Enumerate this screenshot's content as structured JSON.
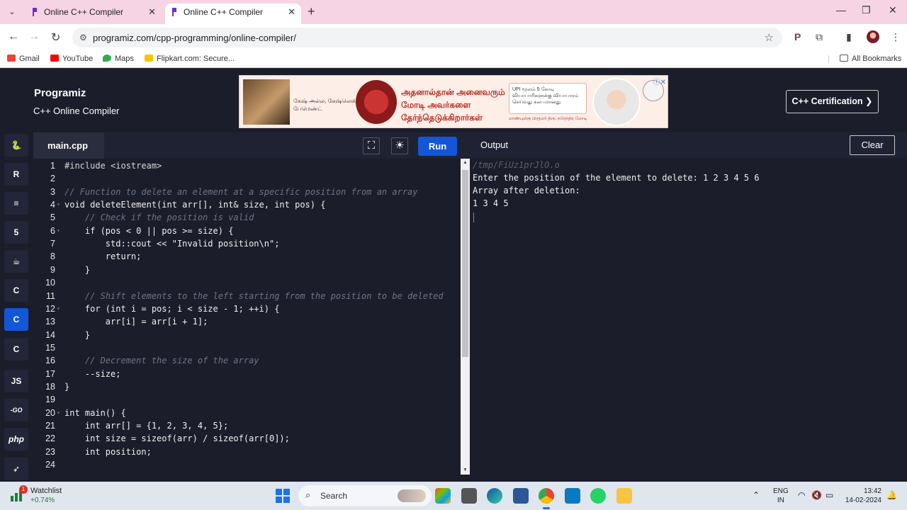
{
  "browser": {
    "tabs": [
      {
        "title": "Online C++ Compiler",
        "active": false
      },
      {
        "title": "Online C++ Compiler",
        "active": true
      }
    ],
    "url": "programiz.com/cpp-programming/online-compiler/",
    "bookmarks": [
      {
        "label": "Gmail",
        "icon": "gmail-icon",
        "color": "#ea4335"
      },
      {
        "label": "YouTube",
        "icon": "youtube-icon",
        "color": "#ff0000"
      },
      {
        "label": "Maps",
        "icon": "maps-icon",
        "color": "#34a853"
      },
      {
        "label": "Flipkart.com: Secure...",
        "icon": "flipkart-icon",
        "color": "#f7c600"
      }
    ],
    "all_bookmarks": "All Bookmarks"
  },
  "site": {
    "logo": "Programiz",
    "subtitle": "C++ Online Compiler",
    "certification": "C++ Certification ❯"
  },
  "ad": {
    "text_left": "கேஷ் அல்ல, கேஷ்லெஸ் பேமெண்ட்",
    "text_main": "அதனால்தான் அனைவரும் மோடி அவர்களை தேர்ந்தெடுக்கிறார்கள்",
    "box_text": "UPI மூலம் 5 கோடி வியாபாரிகளுக்கு வியாபாரம் செய்வது சுலபமானது.",
    "footer": "மாண்புமிகு பிரதமர் திரு. நரேந்திர மோடி"
  },
  "rail": {
    "items": [
      {
        "name": "python",
        "label": "🐍"
      },
      {
        "name": "r",
        "label": "R"
      },
      {
        "name": "sql",
        "label": "≡"
      },
      {
        "name": "html",
        "label": "5"
      },
      {
        "name": "java",
        "label": "☕"
      },
      {
        "name": "c",
        "label": "C"
      },
      {
        "name": "cpp",
        "label": "C",
        "active": true
      },
      {
        "name": "csharp",
        "label": "C"
      },
      {
        "name": "js",
        "label": "JS"
      },
      {
        "name": "go",
        "label": "-GO"
      },
      {
        "name": "php",
        "label": "php"
      },
      {
        "name": "swift",
        "label": "➶"
      }
    ]
  },
  "editor": {
    "filename": "main.cpp",
    "run_label": "Run",
    "lines": [
      "#include <iostream>",
      "",
      "// Function to delete an element at a specific position from an array",
      "void deleteElement(int arr[], int& size, int pos) {",
      "    // Check if the position is valid",
      "    if (pos < 0 || pos >= size) {",
      "        std::cout << \"Invalid position\\n\";",
      "        return;",
      "    }",
      "",
      "    // Shift elements to the left starting from the position to be deleted",
      "    for (int i = pos; i < size - 1; ++i) {",
      "        arr[i] = arr[i + 1];",
      "    }",
      "",
      "    // Decrement the size of the array",
      "    --size;",
      "}",
      "",
      "int main() {",
      "    int arr[] = {1, 2, 3, 4, 5};",
      "    int size = sizeof(arr) / sizeof(arr[0]);",
      "    int position;",
      ""
    ]
  },
  "output": {
    "title": "Output",
    "clear_label": "Clear",
    "lines": [
      "/tmp/FiUz1prJlO.o",
      "Enter the position of the element to delete: 1 2 3 4 5 6",
      "Array after deletion:",
      "1 3 4 5"
    ]
  },
  "taskbar": {
    "watchlist": "Watchlist",
    "watchlist_change": "+0.74%",
    "badge": "1",
    "search": "Search",
    "lang_1": "ENG",
    "lang_2": "IN",
    "time": "13:42",
    "date": "14-02-2024"
  }
}
